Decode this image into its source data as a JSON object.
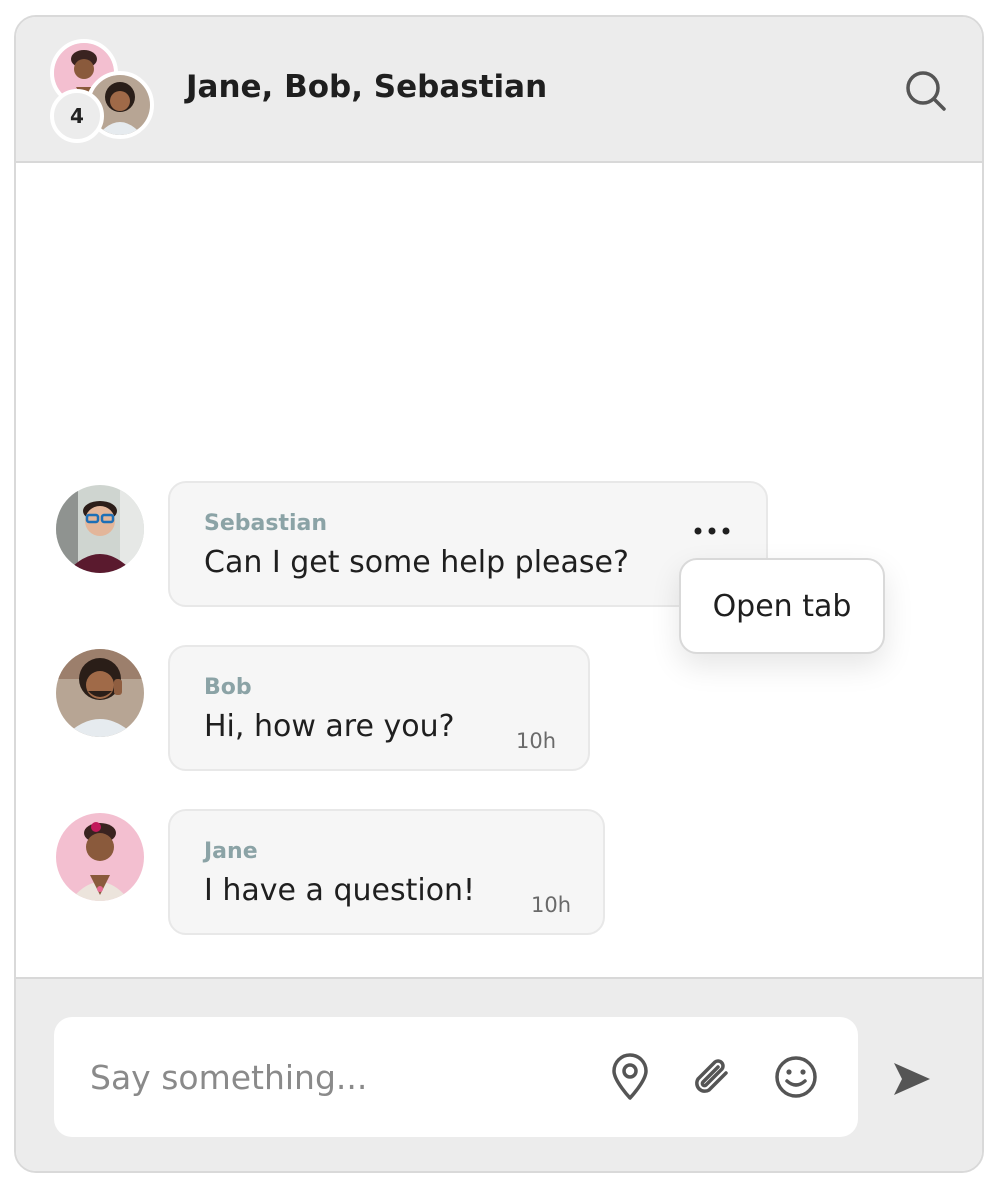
{
  "header": {
    "title": "Jane, Bob, Sebastian",
    "participant_count": "4",
    "search_icon": "search-icon"
  },
  "messages": [
    {
      "sender": "Sebastian",
      "text": "Can I get some help please?",
      "time": "",
      "avatar": "avatar-sebastian",
      "more_icon": "more-horizontal-icon"
    },
    {
      "sender": "Bob",
      "text": "Hi, how are you?",
      "time": "10h",
      "avatar": "avatar-bob"
    },
    {
      "sender": "Jane",
      "text": "I have a question!",
      "time": "10h",
      "avatar": "avatar-jane"
    }
  ],
  "popup": {
    "label": "Open tab"
  },
  "composer": {
    "placeholder": "Say something...",
    "icons": [
      "location-pin-icon",
      "paperclip-icon",
      "smiley-icon",
      "send-icon"
    ]
  },
  "colors": {
    "header_bg": "#ececec",
    "bubble_bg": "#f6f6f6",
    "sender_name": "#8ba3a6",
    "text": "#1f1f1f",
    "jane_avatar_bg": "#f3bfd0",
    "bob_avatar_bg": "#b7a594",
    "sebastian_avatar_bg": "#cfd5d0"
  }
}
